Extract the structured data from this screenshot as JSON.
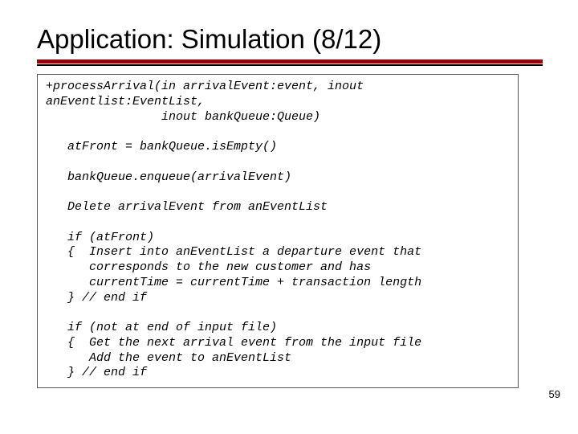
{
  "title": "Application: Simulation (8/12)",
  "code": {
    "sig1": "+processArrival(in arrivalEvent:event, inout",
    "sig2": "anEventlist:EventList,",
    "sig3": "                inout bankQueue:Queue)",
    "l1": "   atFront = bankQueue.isEmpty()",
    "l2": "   bankQueue.enqueue(arrivalEvent)",
    "l3": "   Delete arrivalEvent from anEventList",
    "l4": "   if (atFront)",
    "l5": "   {  Insert into anEventList a departure event that",
    "l6": "      corresponds to the new customer and has",
    "l7": "      currentTime = currentTime + transaction length",
    "l8": "   } // end if",
    "l9": "   if (not at end of input file)",
    "l10": "   {  Get the next arrival event from the input file",
    "l11": "      Add the event to anEventList",
    "l12": "   } // end if"
  },
  "page_number": "59"
}
